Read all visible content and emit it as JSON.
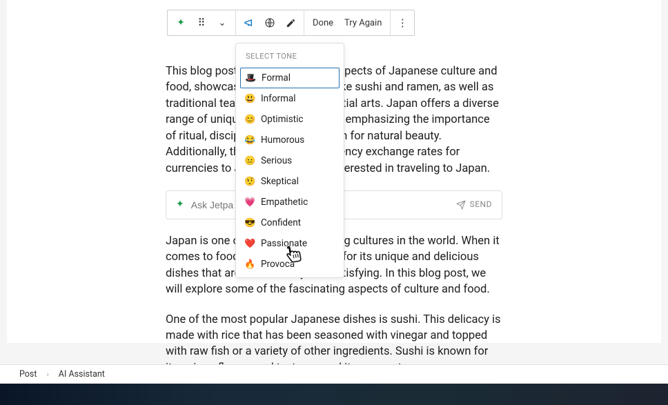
{
  "toolbar": {
    "done_label": "Done",
    "try_again_label": "Try Again"
  },
  "dropdown": {
    "header": "SELECT TONE",
    "items": [
      {
        "emoji": "🎩",
        "label": "Formal"
      },
      {
        "emoji": "😃",
        "label": "Informal"
      },
      {
        "emoji": "😊",
        "label": "Optimistic"
      },
      {
        "emoji": "😂",
        "label": "Humorous"
      },
      {
        "emoji": "😐",
        "label": "Serious"
      },
      {
        "emoji": "🤨",
        "label": "Skeptical"
      },
      {
        "emoji": "💗",
        "label": "Empathetic"
      },
      {
        "emoji": "😎",
        "label": "Confident"
      },
      {
        "emoji": "❤️",
        "label": "Passionate"
      },
      {
        "emoji": "🔥",
        "label": "Provoca"
      }
    ]
  },
  "paragraphs": {
    "p1": "This blog post highlights various aspects of Japanese culture and food, showcasing popular dishes like sushi and ramen, as well as traditional tea ceremonies and martial arts. Japan offers a diverse range of unique cuisine and culture emphasizing the importance of ritual, discipline, and appreciation for natural beauty. Additionally, the blog provides currency exchange rates for currencies to JPY for individuals interested in traveling to Japan.",
    "p2": "Japan is one of the most fascinating cultures in the world. When it comes to food, Japan is renowned for its unique and delicious dishes that are both healthy and satisfying. In this blog post, we will explore some of the fascinating aspects of culture and food.",
    "p3": "One of the most popular Japanese dishes is sushi. This delicacy is made with rice that has been seasoned with vinegar and topped with raw fish or a variety of other ingredients. Sushi is known for its unique flavors and textures, and it represents an"
  },
  "ask": {
    "placeholder": "Ask Jetpa",
    "send_label": "SEND"
  },
  "breadcrumb": {
    "root": "Post",
    "leaf": "AI Assistant"
  }
}
